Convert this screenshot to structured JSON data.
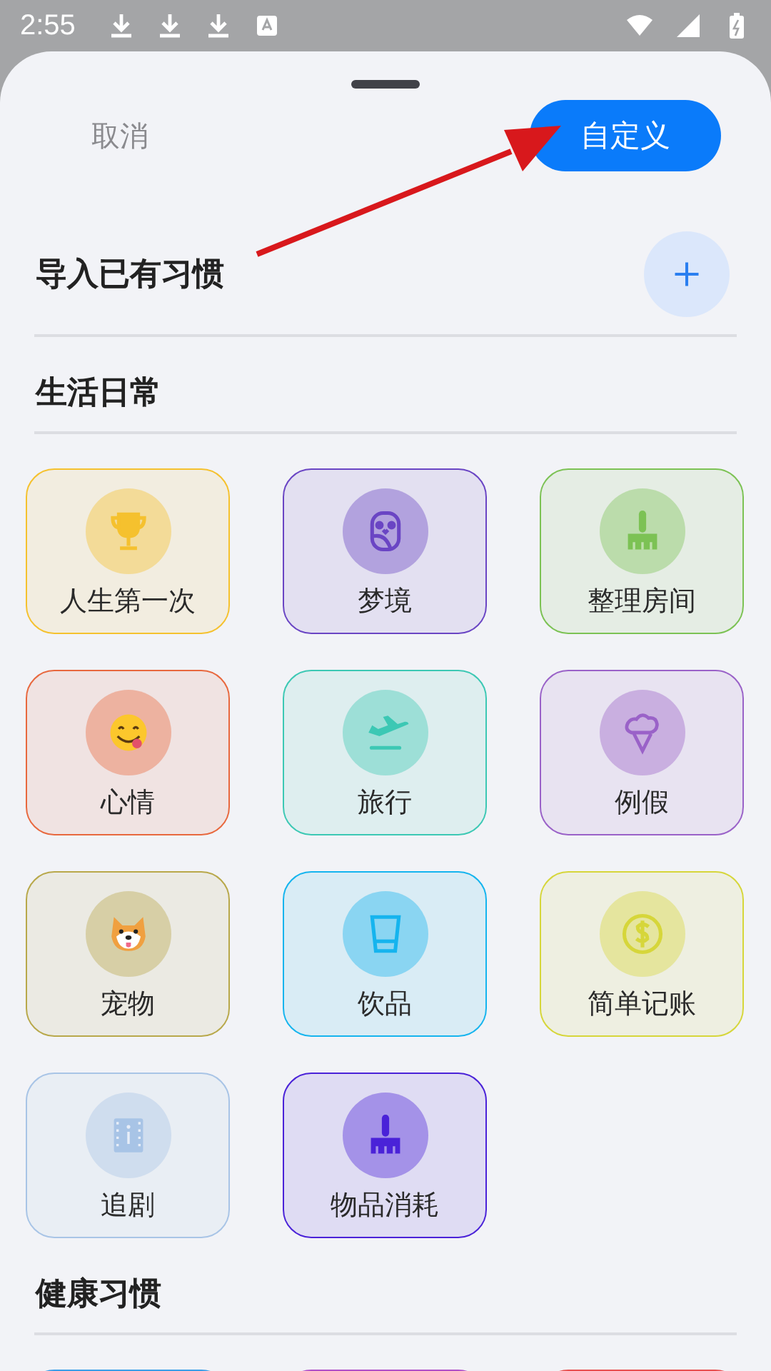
{
  "status_bar": {
    "time": "2:55"
  },
  "header": {
    "cancel": "取消",
    "customize": "自定义"
  },
  "import": {
    "title": "导入已有习惯"
  },
  "sections": [
    {
      "title": "生活日常",
      "cards": [
        {
          "label": "人生第一次",
          "kind": "trophy",
          "color": "#f5c12e"
        },
        {
          "label": "梦境",
          "kind": "owl",
          "color": "#6a45c4"
        },
        {
          "label": "整理房间",
          "kind": "brush",
          "color": "#7cc254"
        },
        {
          "label": "心情",
          "kind": "smile",
          "color": "#e8683e"
        },
        {
          "label": "旅行",
          "kind": "plane",
          "color": "#3cc8b4"
        },
        {
          "label": "例假",
          "kind": "icecream",
          "color": "#9a62c8"
        },
        {
          "label": "宠物",
          "kind": "dog",
          "color": "#b8a84a"
        },
        {
          "label": "饮品",
          "kind": "cup",
          "color": "#15b4ee"
        },
        {
          "label": "简单记账",
          "kind": "coin",
          "color": "#d6d63a"
        },
        {
          "label": "追剧",
          "kind": "film",
          "color": "#a8c4e6"
        },
        {
          "label": "物品消耗",
          "kind": "brush2",
          "color": "#4a22d8"
        }
      ]
    },
    {
      "title": "健康习惯",
      "cards": [
        {
          "color": "#3a9ee8"
        },
        {
          "color": "#b050c8"
        },
        {
          "color": "#e85050"
        }
      ]
    }
  ]
}
